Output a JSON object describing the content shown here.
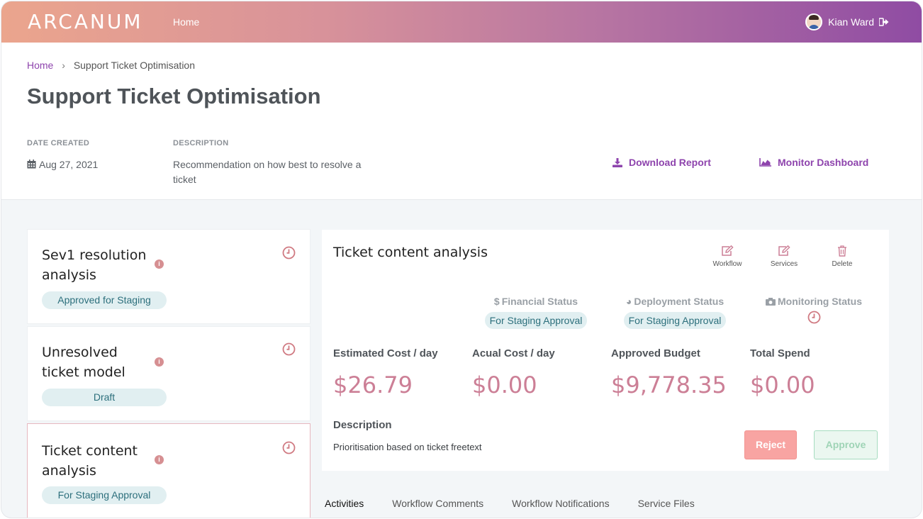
{
  "nav": {
    "logo": "ARCANUM",
    "home": "Home",
    "user_name": "Kian Ward"
  },
  "breadcrumb": {
    "home": "Home",
    "separator": "›",
    "current": "Support Ticket Optimisation"
  },
  "page": {
    "title": "Support Ticket Optimisation",
    "date_label": "DATE CREATED",
    "date_value": "Aug 27, 2021",
    "description_label": "DESCRIPTION",
    "description_line1": "Recommendation on how best to resolve a",
    "description_line2": "ticket",
    "download_report": "Download Report",
    "monitor_dashboard": "Monitor Dashboard"
  },
  "models": [
    {
      "title_line1": "Sev1 resolution",
      "title_line2": "analysis",
      "status": "Approved for Staging"
    },
    {
      "title_line1": "Unresolved",
      "title_line2": "ticket model",
      "status": "Draft"
    },
    {
      "title_line1": "Ticket content",
      "title_line2": "analysis",
      "status": "For Staging Approval"
    }
  ],
  "detail": {
    "title": "Ticket content analysis",
    "actions": {
      "workflow": "Workflow",
      "services": "Services",
      "delete": "Delete"
    },
    "financial_status_label": "Financial Status",
    "financial_status_value": "For Staging Approval",
    "deployment_status_label": "Deployment Status",
    "deployment_status_value": "For Staging Approval",
    "monitoring_status_label": "Monitoring Status",
    "metrics": {
      "estimated_cost_label": "Estimated Cost / day",
      "estimated_cost_value": "$26.79",
      "actual_cost_label": "Acual Cost / day",
      "actual_cost_value": "$0.00",
      "approved_budget_label": "Approved Budget",
      "approved_budget_value": "$9,778.35",
      "total_spend_label": "Total Spend",
      "total_spend_value": "$0.00"
    },
    "description_label": "Description",
    "description_text": "Prioritisation based on ticket freetext",
    "reject": "Reject",
    "approve": "Approve"
  },
  "tabs": [
    "Activities",
    "Workflow Comments",
    "Workflow Notifications",
    "Service Files"
  ],
  "colors": {
    "accent": "#8e44ad",
    "metric": "#cc7f96",
    "pill_bg": "#e1eff1",
    "pill_text": "#2c6f7c",
    "reject": "#f8a4a2",
    "approve_border": "#a6dcbf"
  }
}
